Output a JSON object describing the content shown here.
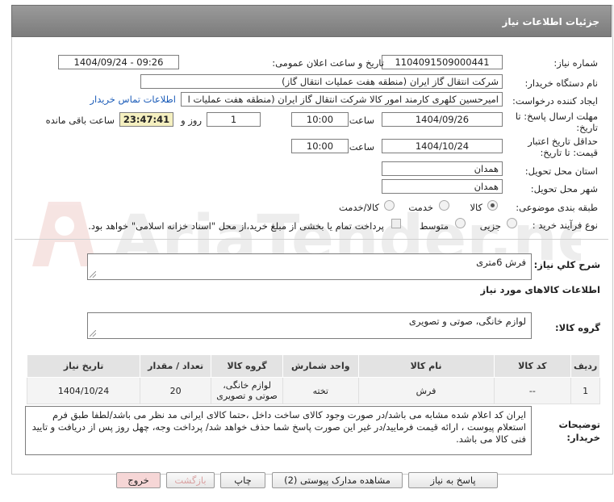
{
  "header": {
    "title": "جزئیات اطلاعات نیاز"
  },
  "fields": {
    "need_number_label": "شماره نیاز:",
    "need_number": "1104091509000441",
    "announce_label": "تاریخ و ساعت اعلان عمومی:",
    "announce_value": "1404/09/24 - 09:26",
    "buyer_org_label": "نام دستگاه خریدار:",
    "buyer_org": "شرکت انتقال گاز ایران (منطقه هفت عملیات انتقال گاز)",
    "creator_label": "ایجاد کننده درخواست:",
    "creator": "امیرحسین کلهری کارمند امور کالا شرکت انتقال گاز ایران (منطقه هفت عملیات ا",
    "contact_link": "اطلاعات تماس خریدار",
    "reply_deadline_label_1": "مهلت ارسال پاسخ: تا",
    "reply_deadline_label_2": "تاریخ:",
    "reply_date": "1404/09/26",
    "time_label": "ساعت",
    "reply_time": "10:00",
    "days_value": "1",
    "days_label": "روز و",
    "remaining_time": "23:47:41",
    "remaining_label": "ساعت باقی مانده",
    "validity_label_1": "حداقل تاریخ اعتبار",
    "validity_label_2": "قیمت: تا تاریخ:",
    "validity_date": "1404/10/24",
    "validity_time": "10:00",
    "province_label": "استان محل تحویل:",
    "province": "همدان",
    "city_label": "شهر محل تحویل:",
    "city": "همدان",
    "category_label": "طبقه بندی موضوعی:",
    "category_options": [
      "کالا",
      "خدمت",
      "کالا/خدمت"
    ],
    "category_selected": "کالا",
    "process_label": "نوع فرآیند خرید :",
    "process_options": [
      "جزیی",
      "متوسط"
    ],
    "payment_note": "پرداخت تمام یا بخشی از مبلغ خرید،از محل \"اسناد خزانه اسلامی\" خواهد بود."
  },
  "summary": {
    "label": "شرح کلي نياز:",
    "value": "فرش 6متری"
  },
  "goods_info": {
    "title": "اطلاعات کالاهای مورد نیاز",
    "group_label": "گروه کالا:",
    "group_value": "لوازم خانگی، صوتی و تصویری"
  },
  "table": {
    "headers": [
      "ردیف",
      "کد کالا",
      "نام کالا",
      "واحد شمارش",
      "گروه کالا",
      "تعداد / مقدار",
      "تاریخ نیاز"
    ],
    "rows": [
      [
        "1",
        "--",
        "فرش",
        "تخته",
        "لوازم خانگی، صوتی و تصویری",
        "20",
        "1404/10/24"
      ]
    ]
  },
  "buyer_notes": {
    "label_1": "توضیحات",
    "label_2": "خریدار:",
    "text": "ایران کد اعلام شده مشابه می باشد/در صورت وجود کالای ساخت داخل ،حتما کالای ایرانی مد نظر می باشد/لطفا طبق فرم استعلام پیوست ، ارائه قیمت فرمایید/در غیر این صورت پاسخ شما حذف خواهد شد/ پرداخت وجه، چهل روز پس از دریافت و تایید فنی کالا می باشد."
  },
  "buttons": {
    "reply": "پاسخ به نیاز",
    "attachments": "مشاهده مدارک پیوستی (2)",
    "print": "چاپ",
    "back": "بازگشت",
    "exit": "خروج"
  },
  "watermark": {
    "text": "AriaTender.net"
  },
  "colors": {
    "header_bg": "#8a8a8a",
    "link": "#1a5bb8",
    "highlight_box": "#f5f0c0",
    "back_button_text": "#d9a0a0",
    "exit_button_bg": "#f6d6d6"
  }
}
